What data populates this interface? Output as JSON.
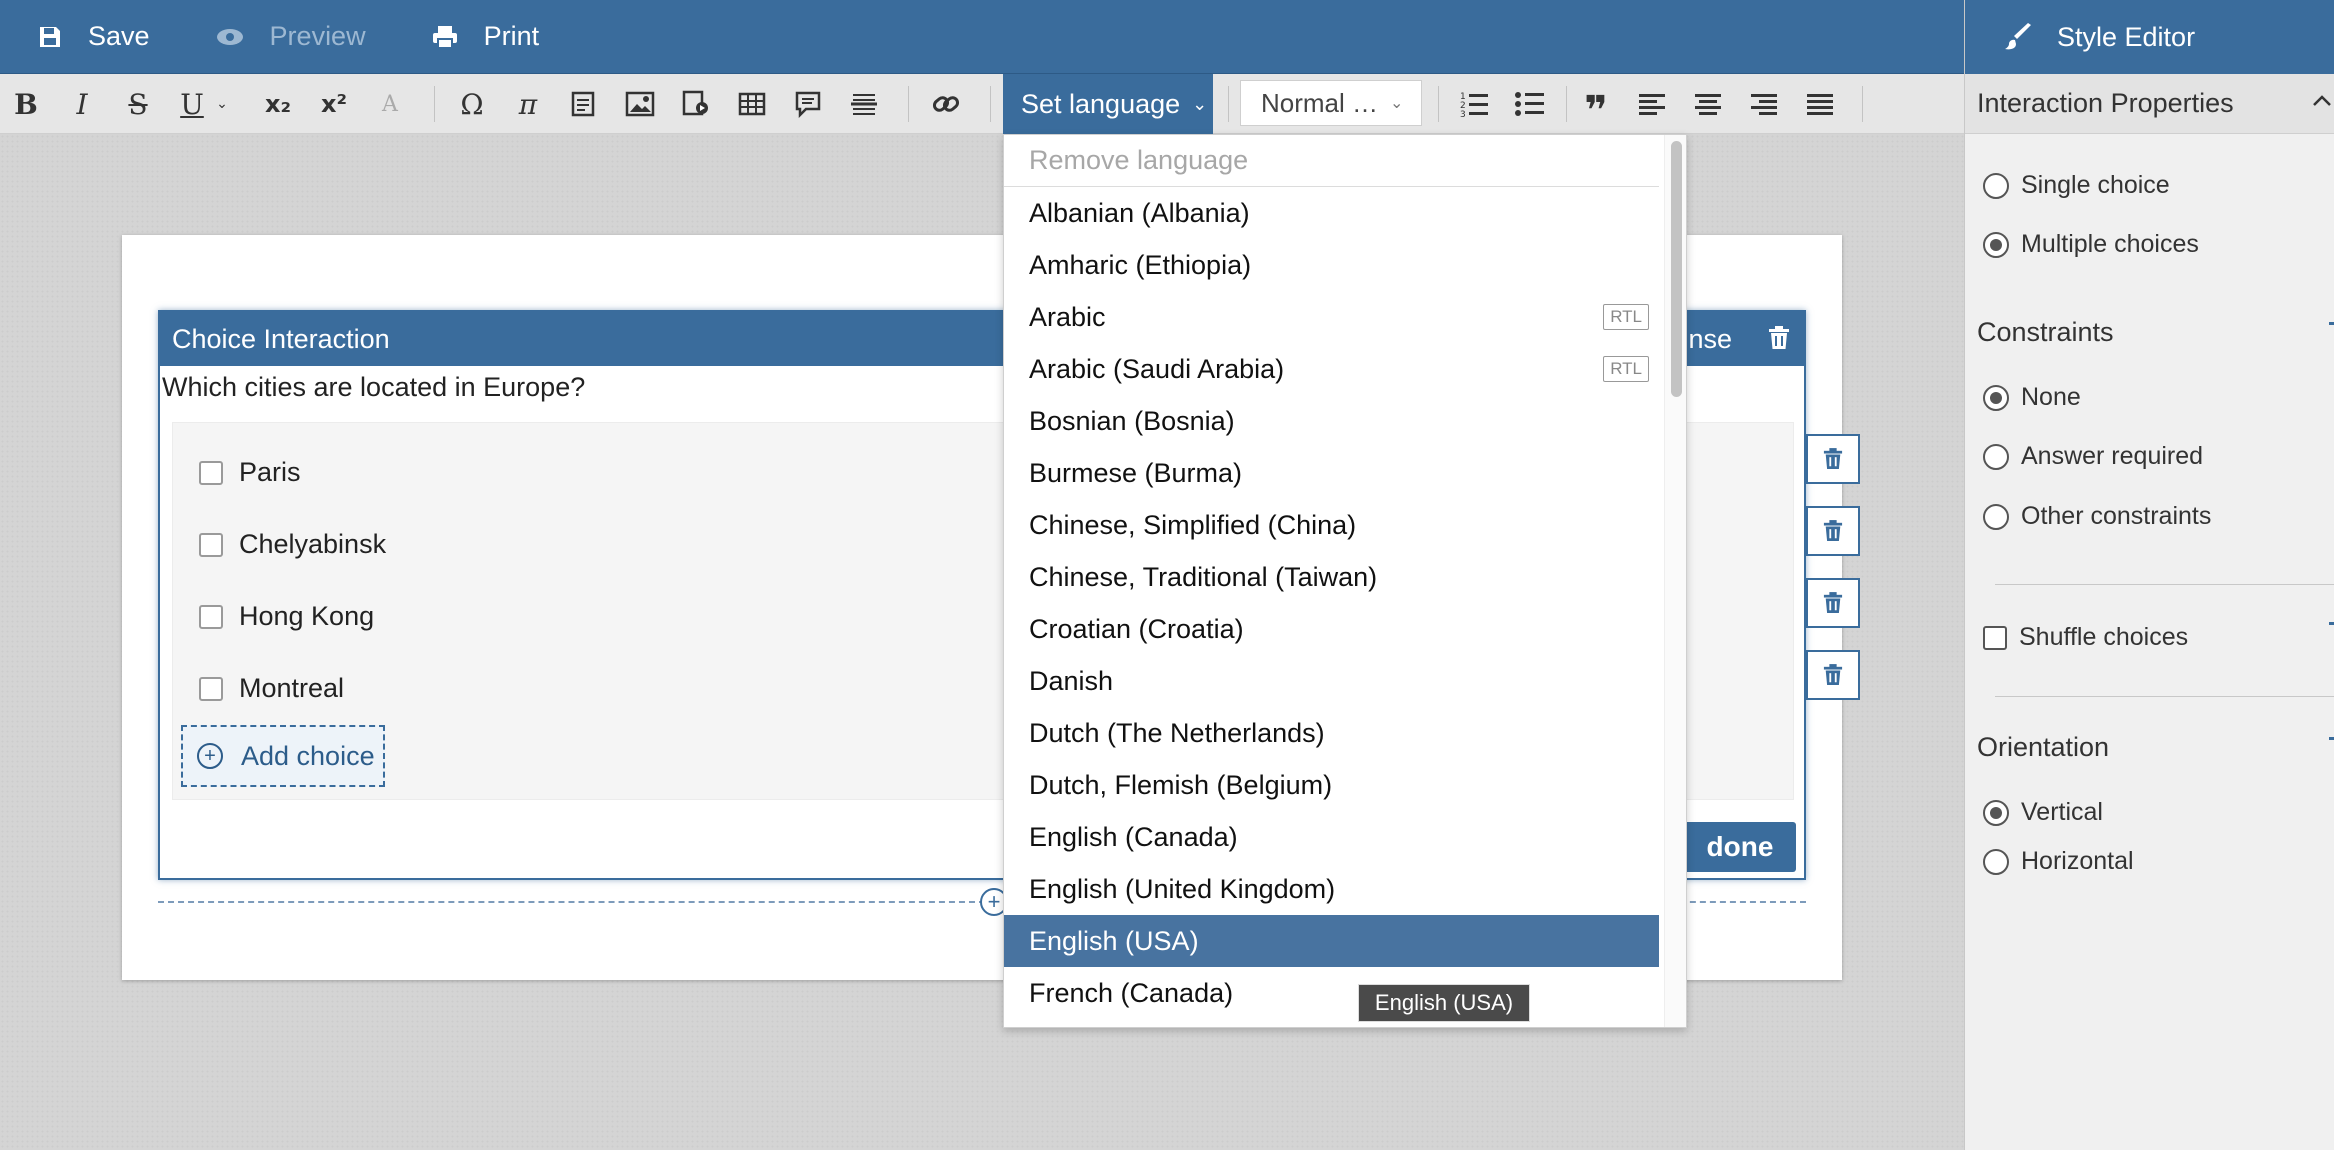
{
  "topbar": {
    "save": "Save",
    "preview": "Preview",
    "print": "Print"
  },
  "toolbar": {
    "set_language": "Set language",
    "format_select": "Normal …"
  },
  "interaction": {
    "header": "Choice Interaction",
    "response_partial": "nse",
    "prompt": "Which cities are located in Europe?",
    "choices": [
      "Paris",
      "Chelyabinsk",
      "Hong Kong",
      "Montreal"
    ],
    "add_choice": "Add choice",
    "done": "done"
  },
  "language_dropdown": {
    "remove": "Remove language",
    "items": [
      "Albanian (Albania)",
      "Amharic (Ethiopia)",
      "Arabic",
      "Arabic (Saudi Arabia)",
      "Bosnian (Bosnia)",
      "Burmese (Burma)",
      "Chinese, Simplified (China)",
      "Chinese, Traditional (Taiwan)",
      "Croatian (Croatia)",
      "Danish",
      "Dutch (The Netherlands)",
      "Dutch, Flemish (Belgium)",
      "English (Canada)",
      "English (United Kingdom)",
      "English (USA)",
      "French (Canada)"
    ],
    "rtl_badge": "RTL",
    "selected": "English (USA)",
    "tooltip": "English (USA)"
  },
  "style_editor": {
    "title": "Style Editor",
    "section": "Interaction Properties",
    "choice_mode": [
      "Single choice",
      "Multiple choices"
    ],
    "choice_mode_selected": "Multiple choices",
    "constraints_label": "Constraints",
    "constraints": [
      "None",
      "Answer required",
      "Other constraints"
    ],
    "constraints_selected": "None",
    "shuffle": "Shuffle choices",
    "shuffle_checked": false,
    "orientation_label": "Orientation",
    "orientation": [
      "Vertical",
      "Horizontal"
    ],
    "orientation_selected": "Vertical"
  },
  "colors": {
    "accent": "#3a6c9c",
    "selected_item": "#4873a0"
  }
}
